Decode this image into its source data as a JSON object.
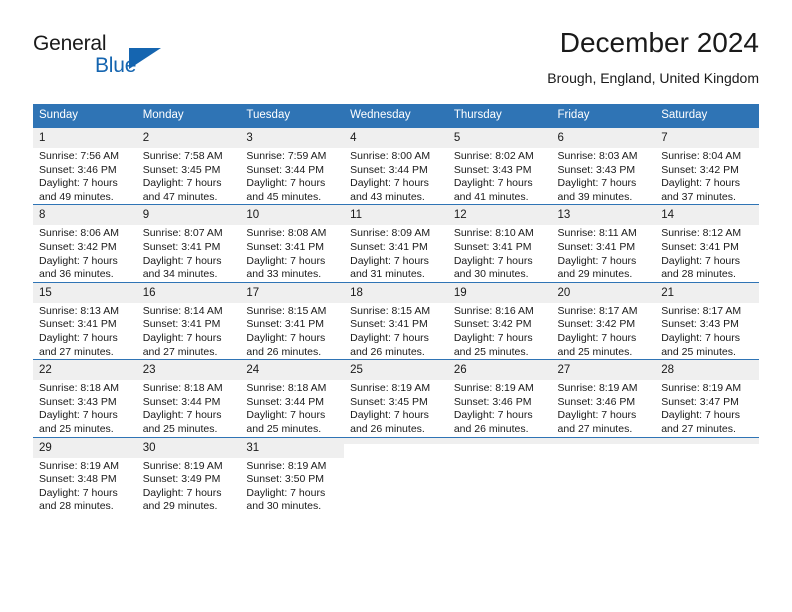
{
  "brand": {
    "name_part1": "General",
    "name_part2": "Blue",
    "accent_color": "#1565b0"
  },
  "header": {
    "title": "December 2024",
    "subtitle": "Brough, England, United Kingdom"
  },
  "theme": {
    "header_bg": "#2f74b5",
    "daynum_bg": "#efefef",
    "text": "#1a1a1a"
  },
  "weekday_headers": [
    "Sunday",
    "Monday",
    "Tuesday",
    "Wednesday",
    "Thursday",
    "Friday",
    "Saturday"
  ],
  "weeks": [
    [
      {
        "day": "1",
        "sunrise": "Sunrise: 7:56 AM",
        "sunset": "Sunset: 3:46 PM",
        "daylight_line1": "Daylight: 7 hours",
        "daylight_line2": "and 49 minutes."
      },
      {
        "day": "2",
        "sunrise": "Sunrise: 7:58 AM",
        "sunset": "Sunset: 3:45 PM",
        "daylight_line1": "Daylight: 7 hours",
        "daylight_line2": "and 47 minutes."
      },
      {
        "day": "3",
        "sunrise": "Sunrise: 7:59 AM",
        "sunset": "Sunset: 3:44 PM",
        "daylight_line1": "Daylight: 7 hours",
        "daylight_line2": "and 45 minutes."
      },
      {
        "day": "4",
        "sunrise": "Sunrise: 8:00 AM",
        "sunset": "Sunset: 3:44 PM",
        "daylight_line1": "Daylight: 7 hours",
        "daylight_line2": "and 43 minutes."
      },
      {
        "day": "5",
        "sunrise": "Sunrise: 8:02 AM",
        "sunset": "Sunset: 3:43 PM",
        "daylight_line1": "Daylight: 7 hours",
        "daylight_line2": "and 41 minutes."
      },
      {
        "day": "6",
        "sunrise": "Sunrise: 8:03 AM",
        "sunset": "Sunset: 3:43 PM",
        "daylight_line1": "Daylight: 7 hours",
        "daylight_line2": "and 39 minutes."
      },
      {
        "day": "7",
        "sunrise": "Sunrise: 8:04 AM",
        "sunset": "Sunset: 3:42 PM",
        "daylight_line1": "Daylight: 7 hours",
        "daylight_line2": "and 37 minutes."
      }
    ],
    [
      {
        "day": "8",
        "sunrise": "Sunrise: 8:06 AM",
        "sunset": "Sunset: 3:42 PM",
        "daylight_line1": "Daylight: 7 hours",
        "daylight_line2": "and 36 minutes."
      },
      {
        "day": "9",
        "sunrise": "Sunrise: 8:07 AM",
        "sunset": "Sunset: 3:41 PM",
        "daylight_line1": "Daylight: 7 hours",
        "daylight_line2": "and 34 minutes."
      },
      {
        "day": "10",
        "sunrise": "Sunrise: 8:08 AM",
        "sunset": "Sunset: 3:41 PM",
        "daylight_line1": "Daylight: 7 hours",
        "daylight_line2": "and 33 minutes."
      },
      {
        "day": "11",
        "sunrise": "Sunrise: 8:09 AM",
        "sunset": "Sunset: 3:41 PM",
        "daylight_line1": "Daylight: 7 hours",
        "daylight_line2": "and 31 minutes."
      },
      {
        "day": "12",
        "sunrise": "Sunrise: 8:10 AM",
        "sunset": "Sunset: 3:41 PM",
        "daylight_line1": "Daylight: 7 hours",
        "daylight_line2": "and 30 minutes."
      },
      {
        "day": "13",
        "sunrise": "Sunrise: 8:11 AM",
        "sunset": "Sunset: 3:41 PM",
        "daylight_line1": "Daylight: 7 hours",
        "daylight_line2": "and 29 minutes."
      },
      {
        "day": "14",
        "sunrise": "Sunrise: 8:12 AM",
        "sunset": "Sunset: 3:41 PM",
        "daylight_line1": "Daylight: 7 hours",
        "daylight_line2": "and 28 minutes."
      }
    ],
    [
      {
        "day": "15",
        "sunrise": "Sunrise: 8:13 AM",
        "sunset": "Sunset: 3:41 PM",
        "daylight_line1": "Daylight: 7 hours",
        "daylight_line2": "and 27 minutes."
      },
      {
        "day": "16",
        "sunrise": "Sunrise: 8:14 AM",
        "sunset": "Sunset: 3:41 PM",
        "daylight_line1": "Daylight: 7 hours",
        "daylight_line2": "and 27 minutes."
      },
      {
        "day": "17",
        "sunrise": "Sunrise: 8:15 AM",
        "sunset": "Sunset: 3:41 PM",
        "daylight_line1": "Daylight: 7 hours",
        "daylight_line2": "and 26 minutes."
      },
      {
        "day": "18",
        "sunrise": "Sunrise: 8:15 AM",
        "sunset": "Sunset: 3:41 PM",
        "daylight_line1": "Daylight: 7 hours",
        "daylight_line2": "and 26 minutes."
      },
      {
        "day": "19",
        "sunrise": "Sunrise: 8:16 AM",
        "sunset": "Sunset: 3:42 PM",
        "daylight_line1": "Daylight: 7 hours",
        "daylight_line2": "and 25 minutes."
      },
      {
        "day": "20",
        "sunrise": "Sunrise: 8:17 AM",
        "sunset": "Sunset: 3:42 PM",
        "daylight_line1": "Daylight: 7 hours",
        "daylight_line2": "and 25 minutes."
      },
      {
        "day": "21",
        "sunrise": "Sunrise: 8:17 AM",
        "sunset": "Sunset: 3:43 PM",
        "daylight_line1": "Daylight: 7 hours",
        "daylight_line2": "and 25 minutes."
      }
    ],
    [
      {
        "day": "22",
        "sunrise": "Sunrise: 8:18 AM",
        "sunset": "Sunset: 3:43 PM",
        "daylight_line1": "Daylight: 7 hours",
        "daylight_line2": "and 25 minutes."
      },
      {
        "day": "23",
        "sunrise": "Sunrise: 8:18 AM",
        "sunset": "Sunset: 3:44 PM",
        "daylight_line1": "Daylight: 7 hours",
        "daylight_line2": "and 25 minutes."
      },
      {
        "day": "24",
        "sunrise": "Sunrise: 8:18 AM",
        "sunset": "Sunset: 3:44 PM",
        "daylight_line1": "Daylight: 7 hours",
        "daylight_line2": "and 25 minutes."
      },
      {
        "day": "25",
        "sunrise": "Sunrise: 8:19 AM",
        "sunset": "Sunset: 3:45 PM",
        "daylight_line1": "Daylight: 7 hours",
        "daylight_line2": "and 26 minutes."
      },
      {
        "day": "26",
        "sunrise": "Sunrise: 8:19 AM",
        "sunset": "Sunset: 3:46 PM",
        "daylight_line1": "Daylight: 7 hours",
        "daylight_line2": "and 26 minutes."
      },
      {
        "day": "27",
        "sunrise": "Sunrise: 8:19 AM",
        "sunset": "Sunset: 3:46 PM",
        "daylight_line1": "Daylight: 7 hours",
        "daylight_line2": "and 27 minutes."
      },
      {
        "day": "28",
        "sunrise": "Sunrise: 8:19 AM",
        "sunset": "Sunset: 3:47 PM",
        "daylight_line1": "Daylight: 7 hours",
        "daylight_line2": "and 27 minutes."
      }
    ],
    [
      {
        "day": "29",
        "sunrise": "Sunrise: 8:19 AM",
        "sunset": "Sunset: 3:48 PM",
        "daylight_line1": "Daylight: 7 hours",
        "daylight_line2": "and 28 minutes."
      },
      {
        "day": "30",
        "sunrise": "Sunrise: 8:19 AM",
        "sunset": "Sunset: 3:49 PM",
        "daylight_line1": "Daylight: 7 hours",
        "daylight_line2": "and 29 minutes."
      },
      {
        "day": "31",
        "sunrise": "Sunrise: 8:19 AM",
        "sunset": "Sunset: 3:50 PM",
        "daylight_line1": "Daylight: 7 hours",
        "daylight_line2": "and 30 minutes."
      },
      {
        "day": "",
        "sunrise": "",
        "sunset": "",
        "daylight_line1": "",
        "daylight_line2": ""
      },
      {
        "day": "",
        "sunrise": "",
        "sunset": "",
        "daylight_line1": "",
        "daylight_line2": ""
      },
      {
        "day": "",
        "sunrise": "",
        "sunset": "",
        "daylight_line1": "",
        "daylight_line2": ""
      },
      {
        "day": "",
        "sunrise": "",
        "sunset": "",
        "daylight_line1": "",
        "daylight_line2": ""
      }
    ]
  ]
}
